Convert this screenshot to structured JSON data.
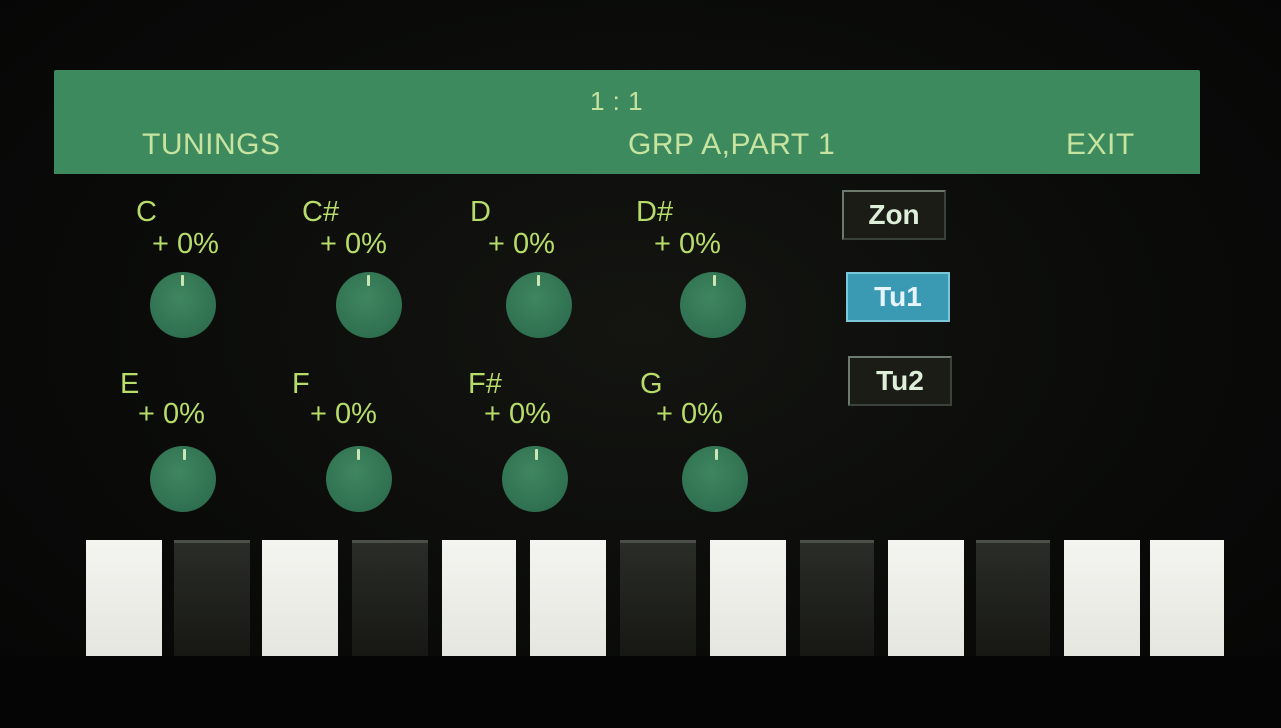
{
  "header": {
    "position": "1 : 1",
    "left_label": "TUNINGS",
    "center_label": "GRP A,PART 1",
    "right_label": "EXIT"
  },
  "tunings": [
    {
      "note": "C",
      "value": "+ 0%"
    },
    {
      "note": "C#",
      "value": "+ 0%"
    },
    {
      "note": "D",
      "value": "+ 0%"
    },
    {
      "note": "D#",
      "value": "+ 0%"
    },
    {
      "note": "E",
      "value": "+ 0%"
    },
    {
      "note": "F",
      "value": "+ 0%"
    },
    {
      "note": "F#",
      "value": "+ 0%"
    },
    {
      "note": "G",
      "value": "+ 0%"
    }
  ],
  "side_buttons": [
    {
      "label": "Zon",
      "active": false
    },
    {
      "label": "Tu1",
      "active": true
    },
    {
      "label": "Tu2",
      "active": false
    }
  ],
  "keyboard": {
    "keys": [
      "white",
      "black",
      "white",
      "black",
      "white",
      "white",
      "black",
      "white",
      "black",
      "white",
      "black",
      "white",
      "white"
    ]
  },
  "colors": {
    "header_bg": "#3d8a5e",
    "text_green": "#b7dc6a",
    "knob": "#2f7050",
    "active_button": "#3a9ab4"
  }
}
